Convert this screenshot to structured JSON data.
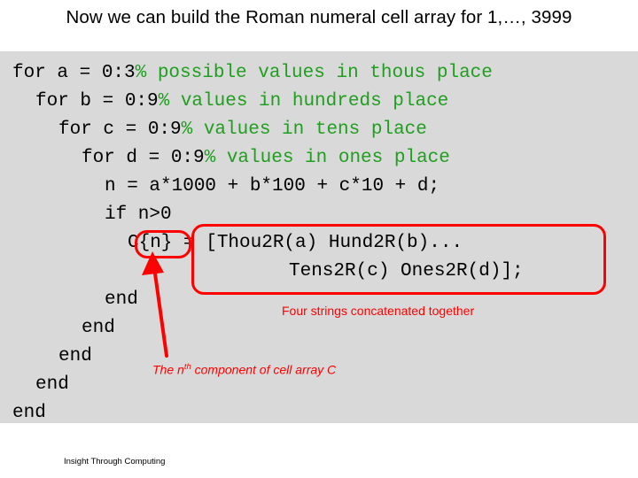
{
  "slide": {
    "title": "Now we can build the Roman numeral cell array for 1,…, 3999",
    "footer": "Insight Through Computing",
    "code": [
      {
        "indent": 0,
        "text": "for a = 0:3",
        "comment": "% possible values in thous place"
      },
      {
        "indent": 1,
        "text": "for b = 0:9",
        "comment": "% values in hundreds place"
      },
      {
        "indent": 2,
        "text": "for c = 0:9",
        "comment": "% values in tens place"
      },
      {
        "indent": 3,
        "text": "for d = 0:9",
        "comment": "% values in ones place"
      },
      {
        "indent": 4,
        "text": "n = a*1000 + b*100 + c*10 + d;",
        "comment": ""
      },
      {
        "indent": 4,
        "text": "if n>0",
        "comment": ""
      },
      {
        "indent": 5,
        "text": "C{n} = [Thou2R(a) Hund2R(b)...",
        "comment": ""
      },
      {
        "indent": 10,
        "text": "Tens2R(c) Ones2R(d)];",
        "comment": ""
      },
      {
        "indent": 4,
        "text": "end",
        "comment": ""
      },
      {
        "indent": 3,
        "text": "end",
        "comment": ""
      },
      {
        "indent": 2,
        "text": "end",
        "comment": ""
      },
      {
        "indent": 1,
        "text": "end",
        "comment": ""
      },
      {
        "indent": 0,
        "text": "end",
        "comment": ""
      }
    ],
    "annotations": {
      "concat": "Four strings concatenated together",
      "nth_prefix": "The n",
      "nth_sup": "th",
      "nth_suffix": " component of cell array C"
    },
    "colors": {
      "code_background": "#d9d9d9",
      "comment": "#1f9e1f",
      "annotation": "#ff0000",
      "text": "#000000"
    }
  }
}
